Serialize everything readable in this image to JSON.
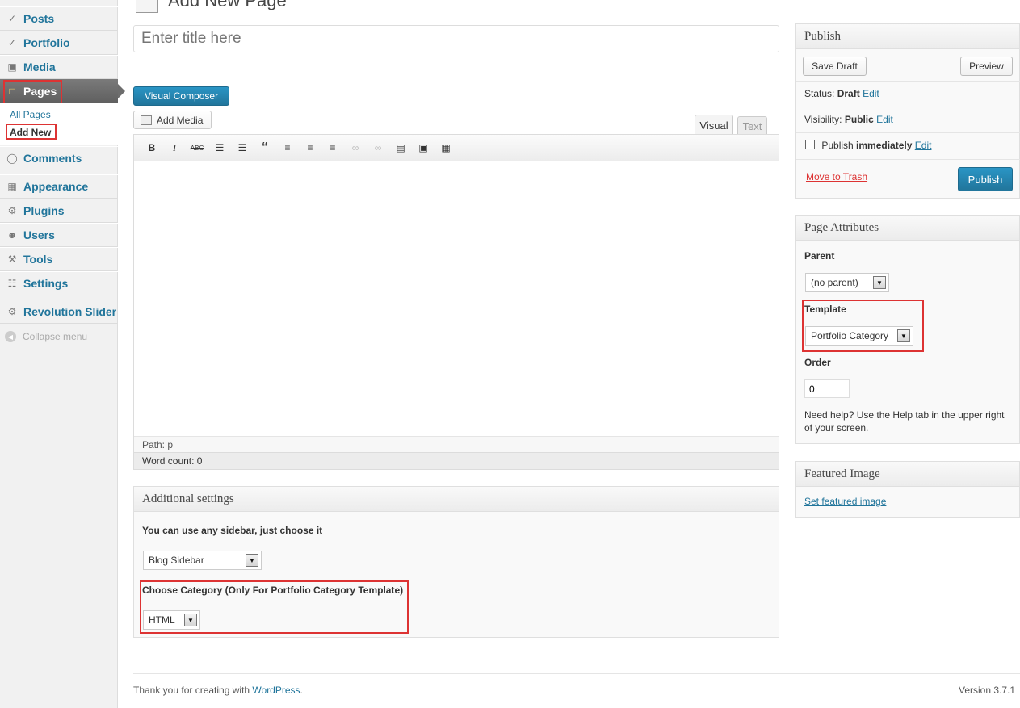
{
  "sidebar": {
    "items": [
      {
        "label": "Posts",
        "icon": "pin-icon"
      },
      {
        "label": "Portfolio",
        "icon": "pin-icon"
      },
      {
        "label": "Media",
        "icon": "media-icon"
      },
      {
        "label": "Pages",
        "icon": "pages-icon"
      },
      {
        "label": "Comments",
        "icon": "comments-icon"
      },
      {
        "label": "Appearance",
        "icon": "appearance-icon"
      },
      {
        "label": "Plugins",
        "icon": "plugins-icon"
      },
      {
        "label": "Users",
        "icon": "users-icon"
      },
      {
        "label": "Tools",
        "icon": "tools-icon"
      },
      {
        "label": "Settings",
        "icon": "settings-icon"
      },
      {
        "label": "Revolution Slider",
        "icon": "gear-icon"
      }
    ],
    "submenu": {
      "all_pages": "All Pages",
      "add_new": "Add New"
    },
    "collapse": "Collapse menu"
  },
  "header": {
    "title": "Add New Page"
  },
  "editor": {
    "title_placeholder": "Enter title here",
    "visual_composer": "Visual Composer",
    "add_media": "Add Media",
    "tab_visual": "Visual",
    "tab_text": "Text",
    "path": "Path: p",
    "word_count": "Word count: 0"
  },
  "additional": {
    "title": "Additional settings",
    "sidebar_label": "You can use any sidebar, just choose it",
    "sidebar_value": "Blog Sidebar",
    "category_label": "Choose Category (Only For Portfolio Category Template)",
    "category_value": "HTML"
  },
  "publish": {
    "title": "Publish",
    "save_draft": "Save Draft",
    "preview": "Preview",
    "status_label": "Status:",
    "status_value": "Draft",
    "visibility_label": "Visibility:",
    "visibility_value": "Public",
    "publish_label": "Publish",
    "publish_value": "immediately",
    "edit": "Edit",
    "trash": "Move to Trash",
    "publish_button": "Publish"
  },
  "attributes": {
    "title": "Page Attributes",
    "parent_label": "Parent",
    "parent_value": "(no parent)",
    "template_label": "Template",
    "template_value": "Portfolio Category",
    "order_label": "Order",
    "order_value": "0",
    "help": "Need help? Use the Help tab in the upper right of your screen."
  },
  "featured": {
    "title": "Featured Image",
    "link": "Set featured image"
  },
  "footer": {
    "thanks": "Thank you for creating with ",
    "wordpress": "WordPress",
    "period": ".",
    "version": "Version 3.7.1"
  },
  "colors": {
    "accent": "#21759b",
    "highlight": "#dd3333"
  }
}
